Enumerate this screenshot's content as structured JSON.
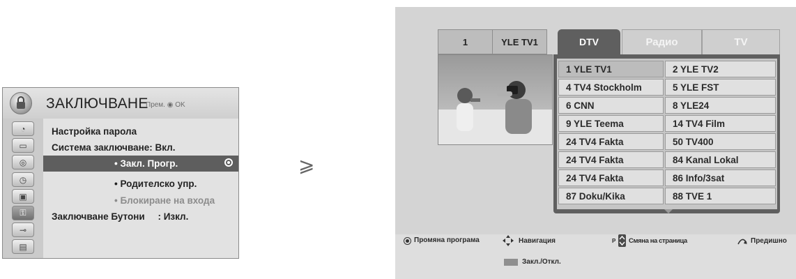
{
  "lock_menu": {
    "title": "ЗАКЛЮЧВАНЕ",
    "hint": "Прем. ◉ OK",
    "items": [
      {
        "label": "Настройка парола"
      },
      {
        "label": "Система заключване: Вкл."
      },
      {
        "label": "• Закл. Прогр."
      },
      {
        "label": "• Родителско упр."
      },
      {
        "label": "• Блокиране на входа"
      },
      {
        "label": "Заключване Бутони     : Изкл."
      }
    ],
    "side_icons": [
      "satellite-icon",
      "screen-icon",
      "audio-icon",
      "clock-icon",
      "option-icon",
      "lock-icon",
      "input-icon",
      "media-icon"
    ]
  },
  "arrow": "⩾",
  "channel_editor": {
    "current_number": "1",
    "current_name": "YLE TV1",
    "tabs": [
      "DTV",
      "Радио",
      "TV"
    ],
    "channels": [
      "1 YLE TV1",
      "2 YLE TV2",
      "4 TV4 Stockholm",
      "5 YLE FST",
      "6 CNN",
      "8 YLE24",
      "9 YLE Teema",
      "14 TV4 Film",
      "24 TV4 Fakta",
      "50 TV400",
      "24 TV4 Fakta",
      "84 Kanal Lokal",
      "24 TV4 Fakta",
      "86 Info/3sat",
      "87 Doku/Kika",
      "88 TVE 1"
    ],
    "legend": {
      "change_program": "Промяна програма",
      "navigation": "Навигация",
      "page_change": "Смяна на страница",
      "page_key": "P",
      "previous": "Предишно",
      "lock_toggle": "Закл./Откл."
    }
  },
  "colors": {
    "selected_row": "#5e5e5e",
    "tab_active": "#5f5f5f",
    "panel_bg": "#d4d4d4"
  }
}
